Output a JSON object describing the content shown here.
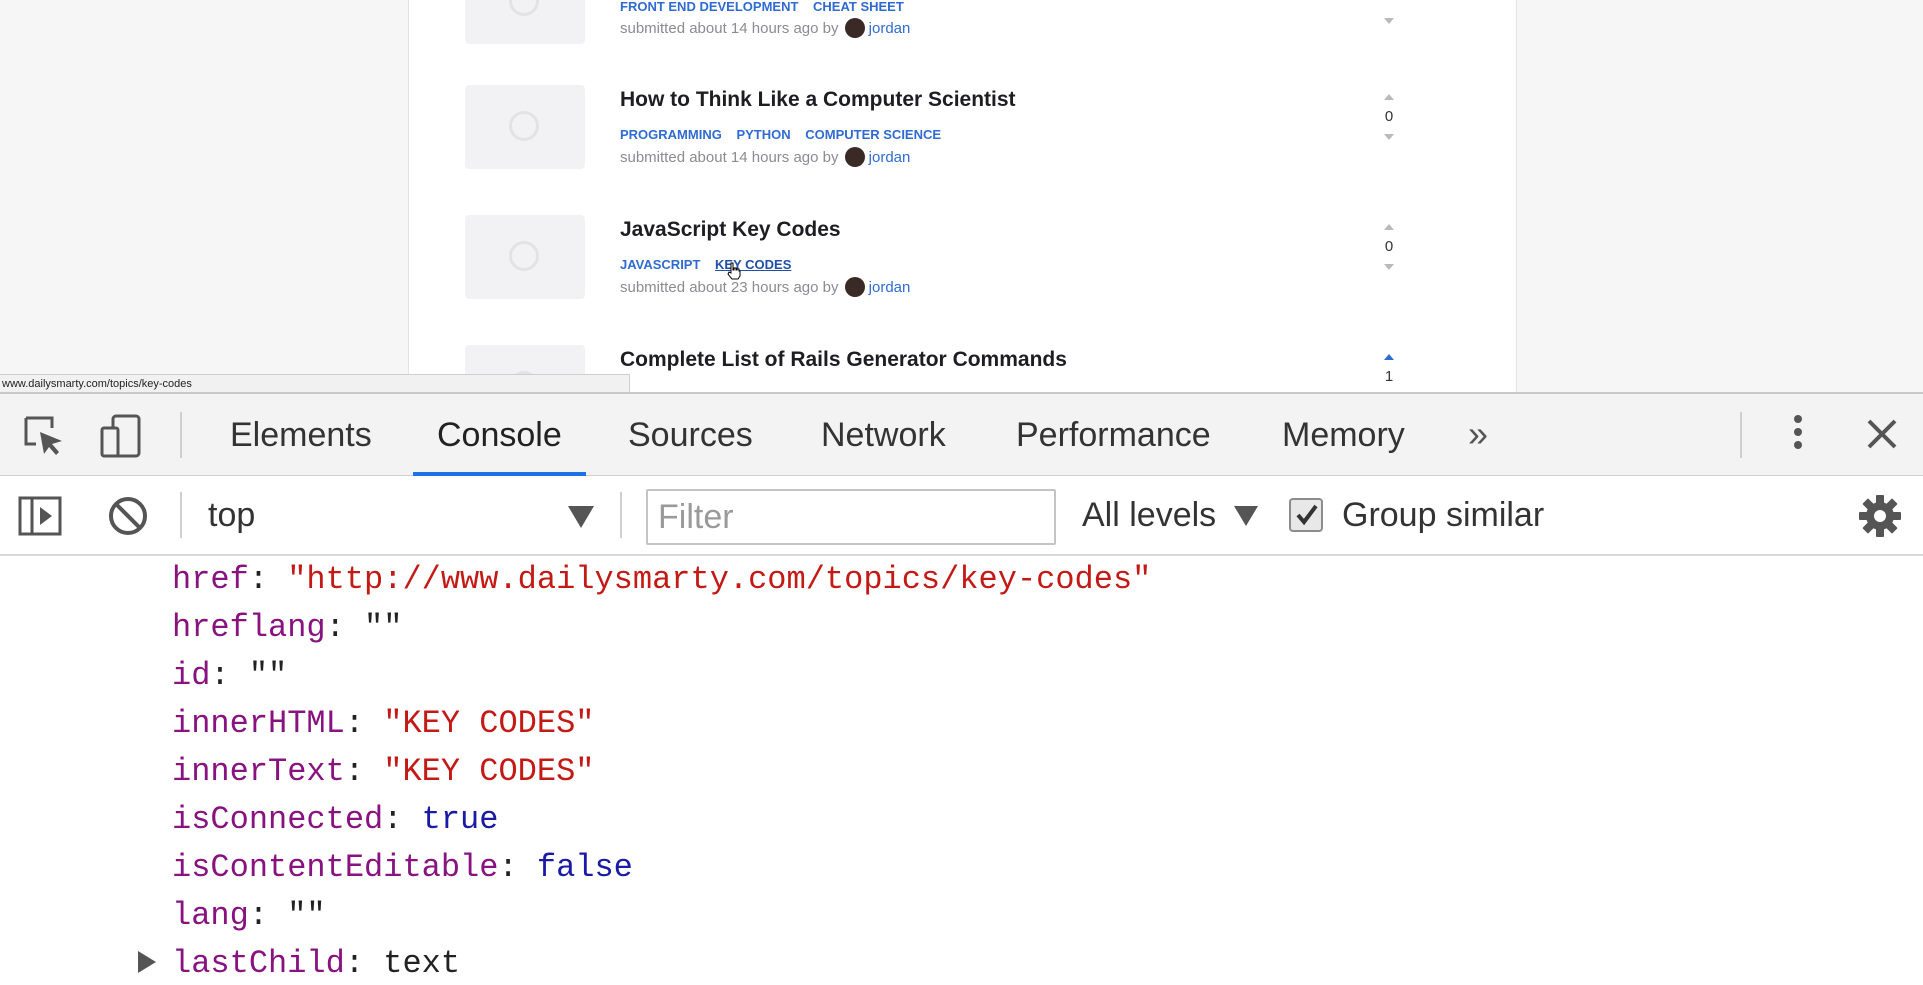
{
  "page": {
    "posts": [
      {
        "title": "",
        "tags": [
          "FRONT END DEVELOPMENT",
          "CHEAT SHEET"
        ],
        "meta": "submitted about 14 hours ago by",
        "user": "jordan",
        "votes": ""
      },
      {
        "title": "How to Think Like a Computer Scientist",
        "tags": [
          "PROGRAMMING",
          "PYTHON",
          "COMPUTER SCIENCE"
        ],
        "meta": "submitted about 14 hours ago by",
        "user": "jordan",
        "votes": "0"
      },
      {
        "title": "JavaScript Key Codes",
        "tags": [
          "JAVASCRIPT",
          "KEY CODES"
        ],
        "meta": "submitted about 23 hours ago by",
        "user": "jordan",
        "votes": "0"
      },
      {
        "title": "Complete List of Rails Generator Commands",
        "tags": [],
        "meta": "",
        "user": "",
        "votes": "1"
      }
    ],
    "status_url": "www.dailysmarty.com/topics/key-codes"
  },
  "devtools": {
    "tabs": [
      "Elements",
      "Console",
      "Sources",
      "Network",
      "Performance",
      "Memory"
    ],
    "active_tab": "Console",
    "more_tabs": "»",
    "toolbar": {
      "context": "top",
      "filter_placeholder": "Filter",
      "levels": "All levels",
      "group_similar_label": "Group similar",
      "group_similar_checked": true
    },
    "output": [
      {
        "key": "href",
        "value": "\"http://www.dailysmarty.com/topics/key-codes\"",
        "type": "string"
      },
      {
        "key": "hreflang",
        "value": "\"\"",
        "type": "empty"
      },
      {
        "key": "id",
        "value": "\"\"",
        "type": "empty"
      },
      {
        "key": "innerHTML",
        "value": "\"KEY CODES\"",
        "type": "string"
      },
      {
        "key": "innerText",
        "value": "\"KEY CODES\"",
        "type": "string"
      },
      {
        "key": "isConnected",
        "value": "true",
        "type": "bool"
      },
      {
        "key": "isContentEditable",
        "value": "false",
        "type": "bool"
      },
      {
        "key": "lang",
        "value": "\"\"",
        "type": "empty"
      },
      {
        "key": "lastChild",
        "value": "text",
        "type": "object",
        "expandable": true
      }
    ]
  },
  "colors": {
    "link_blue": "#2f6bd2",
    "devtools_accent": "#1a73e8",
    "key_purple": "#881280",
    "string_red": "#c41a16",
    "bool_blue": "#1a1aa6"
  },
  "icons": {
    "inspect": "cursor-in-box-icon",
    "device": "device-toolbar-icon",
    "sidebar": "show-sidebar-icon",
    "clear": "clear-console-icon",
    "settings": "gear-icon",
    "close": "close-icon",
    "menu": "kebab-menu-icon"
  }
}
